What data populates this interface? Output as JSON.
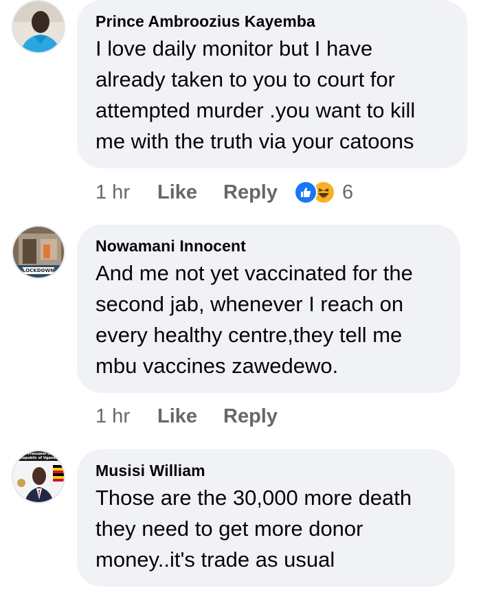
{
  "comments": [
    {
      "author": "Prince Ambroozius Kayemba",
      "lines": [
        "I love daily monitor but I have",
        "already taken to you to court for",
        "attempted murder .you want to kill",
        "me with the truth via your catoons"
      ],
      "time": "1 hr",
      "like_label": "Like",
      "reply_label": "Reply",
      "reactions": [
        "like-reaction-icon",
        "haha-reaction-icon"
      ],
      "reaction_count": "6"
    },
    {
      "author": "Nowamani Innocent",
      "lines": [
        "And me not yet vaccinated for the",
        "second jab, whenever I reach on",
        "every healthy centre,they tell me",
        "mbu vaccines zawedewo."
      ],
      "time": "1 hr",
      "like_label": "Like",
      "reply_label": "Reply",
      "avatar_badge": "LOCKDOWN"
    },
    {
      "author": "Musisi William",
      "lines": [
        "Those are the 30,000 more death",
        "they need to get more donor",
        "money..it's trade as usual"
      ],
      "avatar_caption": "The President of the Republic of Uganda"
    }
  ],
  "colors": {
    "bubble": "#f0f2f5",
    "meta_text": "#65676b",
    "like_blue": "#1877f2",
    "haha_yellow": "#f7b125"
  }
}
